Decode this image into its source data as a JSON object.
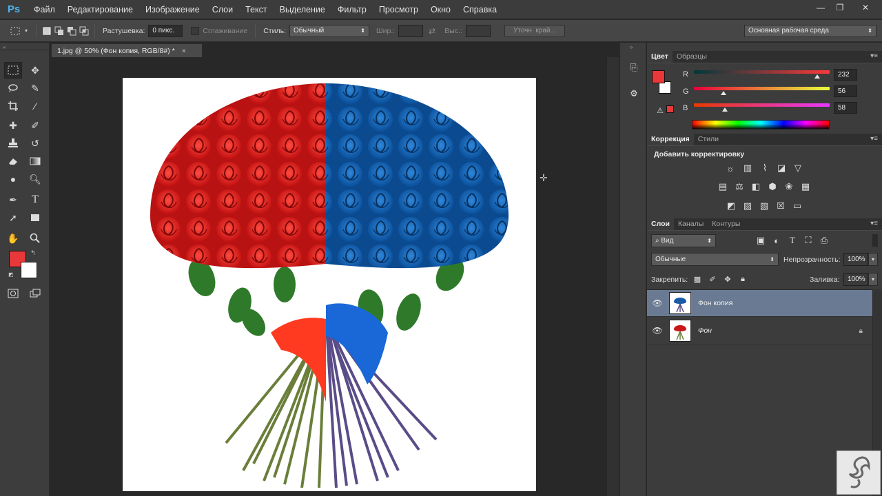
{
  "app": {
    "logo": "Ps"
  },
  "menu": [
    "Файл",
    "Редактирование",
    "Изображение",
    "Слои",
    "Текст",
    "Выделение",
    "Фильтр",
    "Просмотр",
    "Окно",
    "Справка"
  ],
  "window_controls": {
    "minimize": "—",
    "restore": "❐",
    "close": "✕"
  },
  "options": {
    "feather_label": "Растушевка:",
    "feather_value": "0 пикс.",
    "antialias_label": "Сглаживание",
    "style_label": "Стиль:",
    "style_value": "Обычный",
    "width_label": "Шир.:",
    "height_label": "Выс.:",
    "refine_button": "Уточн. край...",
    "workspace": "Основная рабочая среда"
  },
  "document": {
    "tab_title": "1.jpg @ 50% (Фон копия, RGB/8#) *",
    "close": "×"
  },
  "colors": {
    "foreground": "#e8383a",
    "background": "#ffffff",
    "accent_layer": "#6a7a92"
  },
  "color_panel": {
    "tabs": [
      "Цвет",
      "Образцы"
    ],
    "r_label": "R",
    "g_label": "G",
    "b_label": "B",
    "r": "232",
    "g": "56",
    "b": "58",
    "r_fraction": 0.91,
    "g_fraction": 0.22,
    "b_fraction": 0.23
  },
  "adjustments": {
    "tabs": [
      "Коррекция",
      "Стили"
    ],
    "title": "Добавить корректировку"
  },
  "layers_panel": {
    "tabs": [
      "Слои",
      "Каналы",
      "Контуры"
    ],
    "filter_label": "Вид",
    "blend_mode": "Обычные",
    "opacity_label": "Непрозрачность:",
    "opacity_value": "100%",
    "lock_label": "Закрепить:",
    "fill_label": "Заливка:",
    "fill_value": "100%",
    "layers": [
      {
        "name": "Фон копия",
        "selected": true
      },
      {
        "name": "Фон",
        "selected": false,
        "locked": true
      }
    ]
  },
  "icons": [
    "move-icon",
    "marquee-icon",
    "lasso-icon",
    "crop-icon",
    "eyedropper-icon",
    "brush-icon",
    "stamp-icon",
    "eraser-icon",
    "gradient-icon",
    "pen-icon",
    "type-icon",
    "hand-icon",
    "zoom-icon",
    "eye-icon",
    "lock-icon"
  ]
}
